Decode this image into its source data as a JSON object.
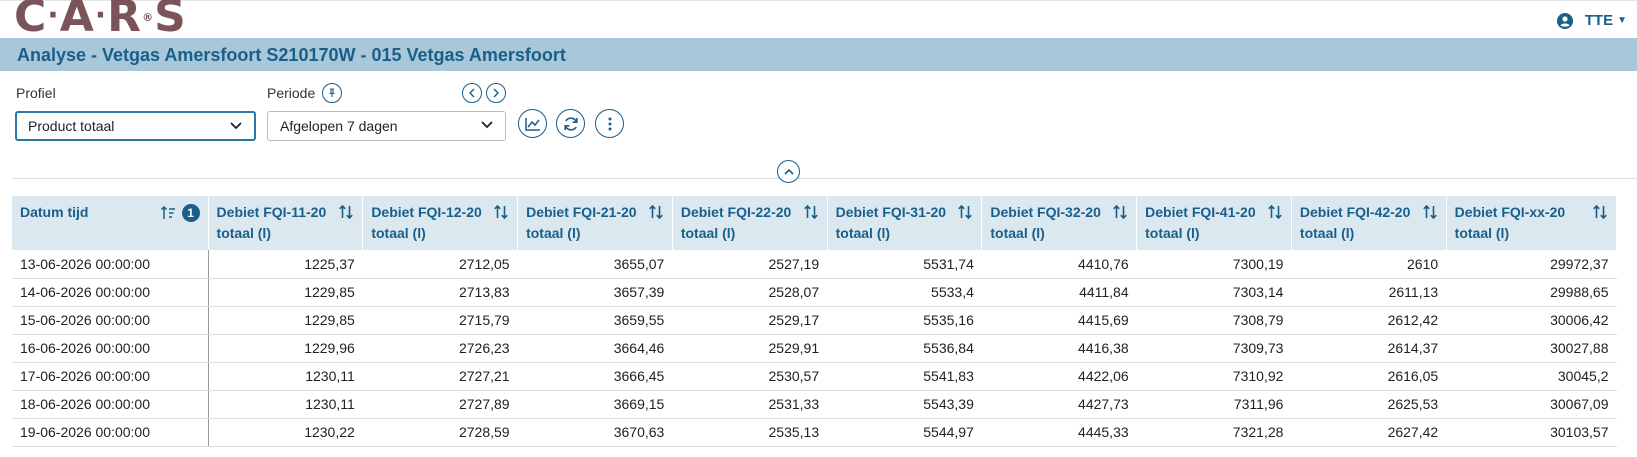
{
  "app": {
    "logo_text": "C·A·R·S",
    "user_label": "TTE"
  },
  "page": {
    "title": "Analyse - Vetgas Amersfoort S210170W - 015 Vetgas Amersfoort"
  },
  "filters": {
    "profiel_label": "Profiel",
    "profiel_value": "Product totaal",
    "periode_label": "Periode",
    "periode_value": "Afgelopen 7 dagen"
  },
  "table": {
    "sort_badge": "1",
    "columns": [
      {
        "line1": "Datum tijd",
        "line2": ""
      },
      {
        "line1": "Debiet FQI-11-20",
        "line2": "totaal (l)"
      },
      {
        "line1": "Debiet FQI-12-20",
        "line2": "totaal (l)"
      },
      {
        "line1": "Debiet FQI-21-20",
        "line2": "totaal (l)"
      },
      {
        "line1": "Debiet FQI-22-20",
        "line2": "totaal (l)"
      },
      {
        "line1": "Debiet FQI-31-20",
        "line2": "totaal (l)"
      },
      {
        "line1": "Debiet FQI-32-20",
        "line2": "totaal (l)"
      },
      {
        "line1": "Debiet FQI-41-20",
        "line2": "totaal (l)"
      },
      {
        "line1": "Debiet FQI-42-20",
        "line2": "totaal (l)"
      },
      {
        "line1": "Debiet FQI-xx-20",
        "line2": "totaal (l)"
      }
    ],
    "rows": [
      [
        "13-06-2026 00:00:00",
        "1225,37",
        "2712,05",
        "3655,07",
        "2527,19",
        "5531,74",
        "4410,76",
        "7300,19",
        "2610",
        "29972,37"
      ],
      [
        "14-06-2026 00:00:00",
        "1229,85",
        "2713,83",
        "3657,39",
        "2528,07",
        "5533,4",
        "4411,84",
        "7303,14",
        "2611,13",
        "29988,65"
      ],
      [
        "15-06-2026 00:00:00",
        "1229,85",
        "2715,79",
        "3659,55",
        "2529,17",
        "5535,16",
        "4415,69",
        "7308,79",
        "2612,42",
        "30006,42"
      ],
      [
        "16-06-2026 00:00:00",
        "1229,96",
        "2726,23",
        "3664,46",
        "2529,91",
        "5536,84",
        "4416,38",
        "7309,73",
        "2614,37",
        "30027,88"
      ],
      [
        "17-06-2026 00:00:00",
        "1230,11",
        "2727,21",
        "3666,45",
        "2530,57",
        "5541,83",
        "4422,06",
        "7310,92",
        "2616,05",
        "30045,2"
      ],
      [
        "18-06-2026 00:00:00",
        "1230,11",
        "2727,89",
        "3669,15",
        "2531,33",
        "5543,39",
        "4427,73",
        "7311,96",
        "2625,53",
        "30067,09"
      ],
      [
        "19-06-2026 00:00:00",
        "1230,22",
        "2728,59",
        "3670,63",
        "2535,13",
        "5544,97",
        "4445,33",
        "7321,28",
        "2627,42",
        "30103,57"
      ]
    ]
  },
  "colors": {
    "accent": "#1a5e8a",
    "title_bar": "#a8c8d9",
    "header_bg": "#dce8f0",
    "logo": "#7a5458"
  }
}
